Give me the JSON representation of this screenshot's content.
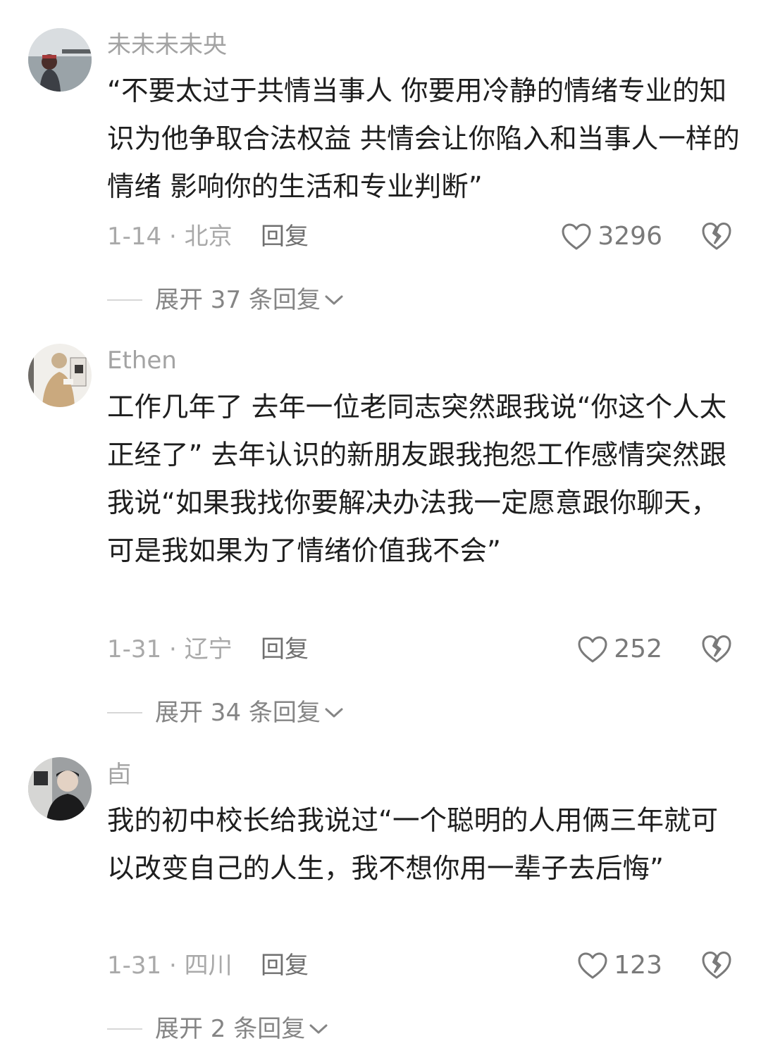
{
  "comments": [
    {
      "username": "未未未未央",
      "text": "“不要太过于共情当事人 你要用冷静的情绪专业的知识为他争取合法权益 共情会让你陷入和当事人一样的情绪 影响你的生活和专业判断”",
      "date_location": "1-14 · 北京",
      "reply_label": "回复",
      "likes": "3296",
      "expand_label": "展开 37 条回复"
    },
    {
      "username": "Ethen",
      "text": "工作几年了 去年一位老同志突然跟我说“你这个人太正经了” 去年认识的新朋友跟我抱怨工作感情突然跟我说“如果我找你要解决办法我一定愿意跟你聊天，可是我如果为了情绪价值我不会”",
      "date_location": "1-31 · 辽宁",
      "reply_label": "回复",
      "likes": "252",
      "expand_label": "展开 34 条回复"
    },
    {
      "username": "卣",
      "text": "我的初中校长给我说过“一个聪明的人用俩三年就可以改变自己的人生，我不想你用一辈子去后悔”",
      "date_location": "1-31 · 四川",
      "reply_label": "回复",
      "likes": "123",
      "expand_label": "展开 2 条回复"
    }
  ],
  "icons": {
    "like": "heart-outline-icon",
    "dislike": "broken-heart-icon",
    "expand": "chevron-down-icon"
  },
  "colors": {
    "background": "#ffffff",
    "text": "#1e1e1e",
    "username": "#a3a3a3",
    "meta": "#a9a9a9",
    "icon": "#7a7a7a"
  }
}
